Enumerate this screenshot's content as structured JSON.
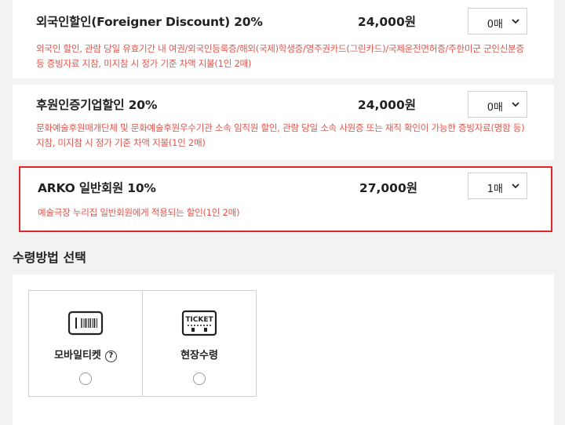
{
  "discounts": [
    {
      "name": "외국인할인(Foreigner Discount) 20%",
      "price": "24,000원",
      "quantity": "0매",
      "description": "외국인 할인, 관람 당일 유효기간 내 여권/외국인등록증/해외(국제)학생증/영주권카드(그린카드)/국제운전면허증/주한미군 군인신분증 등 증빙자료 지참, 미지참 시 정가 기준 차액 지불(1인 2매)"
    },
    {
      "name": "후원인증기업할인 20%",
      "price": "24,000원",
      "quantity": "0매",
      "description": "문화예술후원매개단체 및 문화예술후원우수기관 소속 임직원 할인, 관람 당일 소속 사원증 또는 재직 확인이 가능한 증빙자료(명함 등) 지참, 미지참 시 정가 기준 차액 지불(1인 2매)"
    },
    {
      "name": "ARKO 일반회원 10%",
      "price": "27,000원",
      "quantity": "1매",
      "description": "예술극장 누리집 일반회원에게 적용되는 할인(1인 2매)"
    }
  ],
  "receipt": {
    "section_title": "수령방법 선택",
    "methods": [
      {
        "label": "모바일티켓",
        "help": "?",
        "icon": "mobile-ticket-icon"
      },
      {
        "label": "현장수령",
        "icon": "ticket-icon",
        "icon_text": "TICKET"
      }
    ]
  },
  "colors": {
    "accent_red": "#e0262b",
    "desc_red": "#e0564e"
  }
}
